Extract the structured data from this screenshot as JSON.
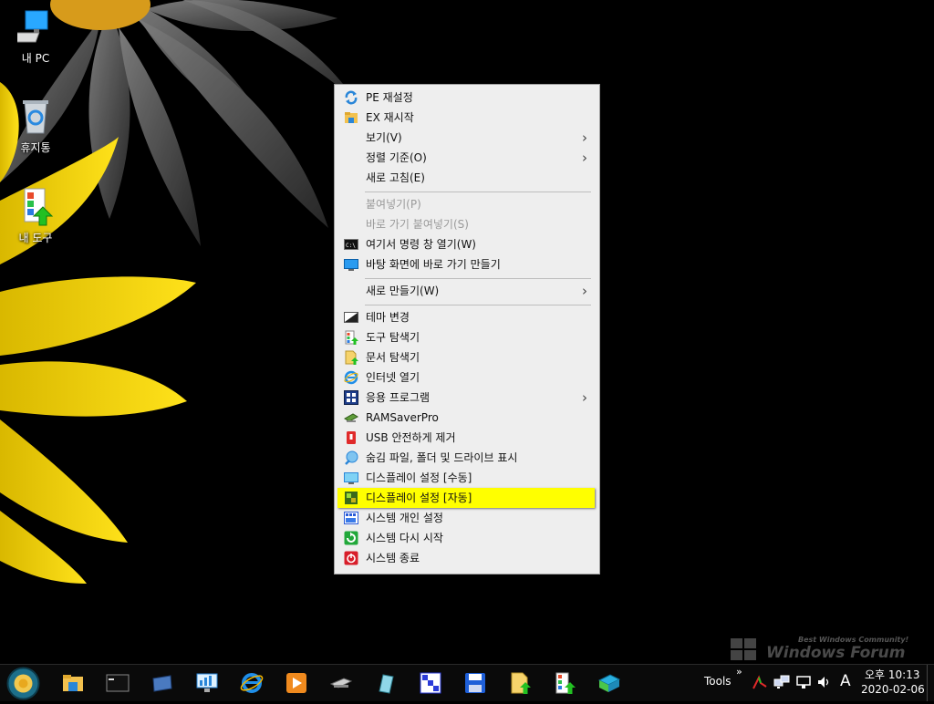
{
  "desktop": {
    "icons": [
      {
        "label": "내 PC"
      },
      {
        "label": "휴지통"
      },
      {
        "label": "내 도구"
      }
    ]
  },
  "context_menu": {
    "items": [
      {
        "label": "PE 재설정",
        "icon": "refresh-icon"
      },
      {
        "label": "EX 재시작",
        "icon": "explorer-folder-icon"
      },
      {
        "label": "보기(V)",
        "submenu": true
      },
      {
        "label": "정렬 기준(O)",
        "submenu": true
      },
      {
        "label": "새로 고침(E)"
      },
      {
        "label": "붙여넣기(P)",
        "disabled": true
      },
      {
        "label": "바로 가기 붙여넣기(S)",
        "disabled": true
      },
      {
        "label": "여기서 명령 창 열기(W)",
        "icon": "command-prompt-icon"
      },
      {
        "label": "바탕 화면에 바로 가기 만들기",
        "icon": "desktop-shortcut-icon"
      },
      {
        "label": "새로 만들기(W)",
        "submenu": true
      },
      {
        "label": "테마 변경",
        "icon": "theme-icon"
      },
      {
        "label": "도구 탐색기",
        "icon": "tools-explorer-icon"
      },
      {
        "label": "문서 탐색기",
        "icon": "document-explorer-icon"
      },
      {
        "label": "인터넷 열기",
        "icon": "internet-explorer-icon"
      },
      {
        "label": "응용 프로그램",
        "icon": "applications-icon",
        "submenu": true
      },
      {
        "label": "RAMSaverPro",
        "icon": "ramsaver-icon"
      },
      {
        "label": "USB 안전하게 제거",
        "icon": "usb-eject-icon"
      },
      {
        "label": "숨김 파일, 폴더 및 드라이브 표시",
        "icon": "hidden-files-icon"
      },
      {
        "label": "디스플레이 설정 [수동]",
        "icon": "display-manual-icon"
      },
      {
        "label": "디스플레이 설정 [자동]",
        "icon": "display-auto-icon",
        "highlighted": true
      },
      {
        "label": "시스템 개인 설정",
        "icon": "personalize-icon"
      },
      {
        "label": "시스템 다시 시작",
        "icon": "restart-icon"
      },
      {
        "label": "시스템 종료",
        "icon": "shutdown-icon"
      }
    ]
  },
  "taskbar": {
    "apps": [
      "explorer",
      "command-prompt",
      "disk-tool",
      "monitor",
      "internet-explorer",
      "media-player",
      "drive-tool",
      "pen-tool",
      "pixel-tool",
      "save",
      "document-explorer",
      "tools-explorer",
      "network-tool"
    ],
    "tray": {
      "toolbar_label": "Tools",
      "ime": "A",
      "time": "오후 10:13",
      "date": "2020-02-06"
    }
  },
  "watermark": {
    "tagline": "Best Windows Community!",
    "brand": "Windows Forum"
  },
  "colors": {
    "highlight": "#ffff00",
    "menu_bg": "#eeeeee",
    "taskbar_bg": "#0a0a0a"
  }
}
